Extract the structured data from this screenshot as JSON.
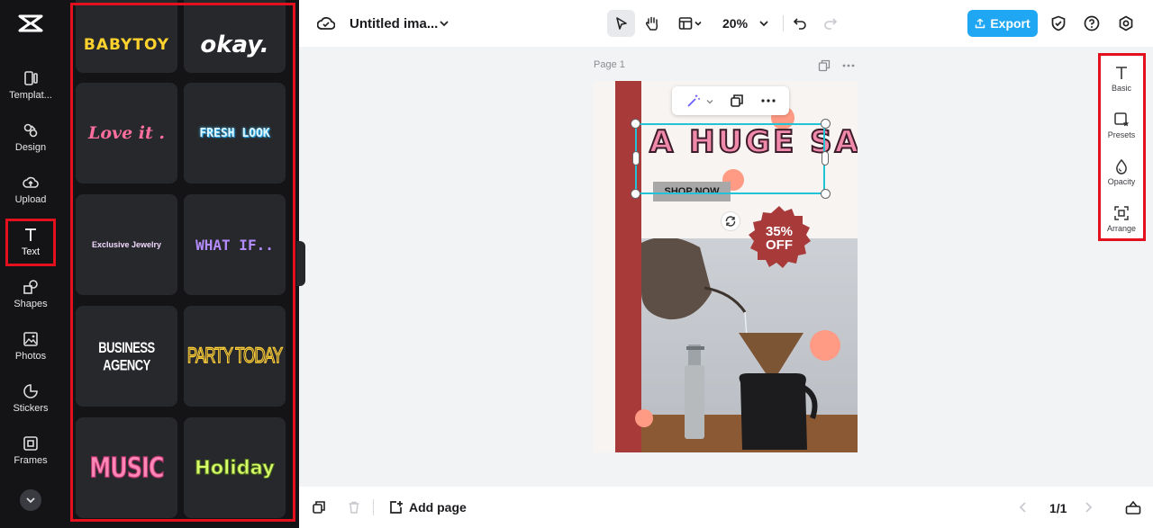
{
  "nav": {
    "items": [
      {
        "label": "Templat..."
      },
      {
        "label": "Design"
      },
      {
        "label": "Upload"
      },
      {
        "label": "Text"
      },
      {
        "label": "Shapes"
      },
      {
        "label": "Photos"
      },
      {
        "label": "Stickers"
      },
      {
        "label": "Frames"
      }
    ]
  },
  "panel": {
    "cards": [
      {
        "text": "BABYTOY"
      },
      {
        "text": "okay."
      },
      {
        "text": "Love it ."
      },
      {
        "text": "FRESH LOOK"
      },
      {
        "text": "Exclusive Jewelry"
      },
      {
        "text": "WHAT IF.."
      },
      {
        "text": "BUSINESS AGENCY"
      },
      {
        "text": "PARTY TODAY"
      },
      {
        "text": "MUSIC"
      },
      {
        "text": "Holiday"
      }
    ]
  },
  "topbar": {
    "title": "Untitled ima...",
    "zoom": "20%",
    "export_label": "Export"
  },
  "canvas": {
    "page_label": "Page 1",
    "headline": "A HUGE SALE",
    "shop_now": "SHOP NOW",
    "badge_line1": "35%",
    "badge_line2": "OFF"
  },
  "props": {
    "items": [
      {
        "label": "Basic"
      },
      {
        "label": "Presets"
      },
      {
        "label": "Opacity"
      },
      {
        "label": "Arrange"
      }
    ]
  },
  "bottombar": {
    "add_page": "Add page",
    "page_count": "1/1"
  },
  "colors": {
    "accent": "#20a7f4",
    "highlight": "#e3101e",
    "selection": "#22c3d6",
    "poster_red": "#a83a3a",
    "peach": "#ff9a84"
  }
}
